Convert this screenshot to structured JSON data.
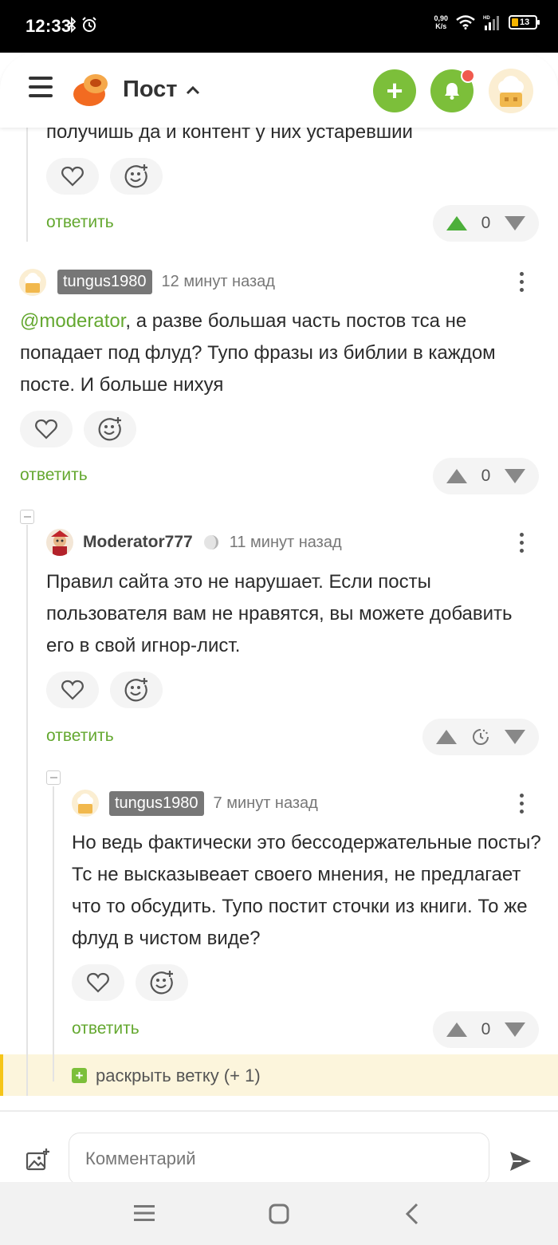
{
  "status_bar": {
    "time": "12:33",
    "speed_value": "0,90",
    "speed_unit": "K/s",
    "battery": "13"
  },
  "header": {
    "title": "Пост",
    "add_label": "+"
  },
  "comments": {
    "partial": {
      "text": "получишь да и контент у них устаревший",
      "reply_label": "ответить",
      "votes": "0"
    },
    "c1": {
      "username": "tungus1980",
      "time": "12 минут назад",
      "mention": "@moderator",
      "text_line1": ", а разве большая часть постов тса не",
      "text_rest": "попадает под флуд? Тупо фразы из библии в каждом посте. И больше нихуя",
      "reply_label": "ответить",
      "votes": "0"
    },
    "c2": {
      "username": "Moderator777",
      "time": "11 минут назад",
      "text": "Правил сайта это не нарушает. Если посты пользователя вам не нравятся, вы можете добавить его в свой игнор-лист.",
      "reply_label": "ответить"
    },
    "c3": {
      "username": "tungus1980",
      "time": "7 минут назад",
      "text": "Но ведь фактически это бессодержательные посты? Тс не высказывеает своего мнения, не предлагает что то обсудить. Тупо постит сточки из книги. То же флуд в чистом виде?",
      "reply_label": "ответить",
      "votes": "0"
    }
  },
  "expand_branch": {
    "plus": "+",
    "label": "раскрыть ветку (+ 1)"
  },
  "comment_input": {
    "placeholder": "Комментарий"
  },
  "colors": {
    "accent_green": "#7cbf3a",
    "link_green": "#64a830",
    "notification_red": "#f05a4e",
    "highlight_yellow": "#f5c518"
  }
}
